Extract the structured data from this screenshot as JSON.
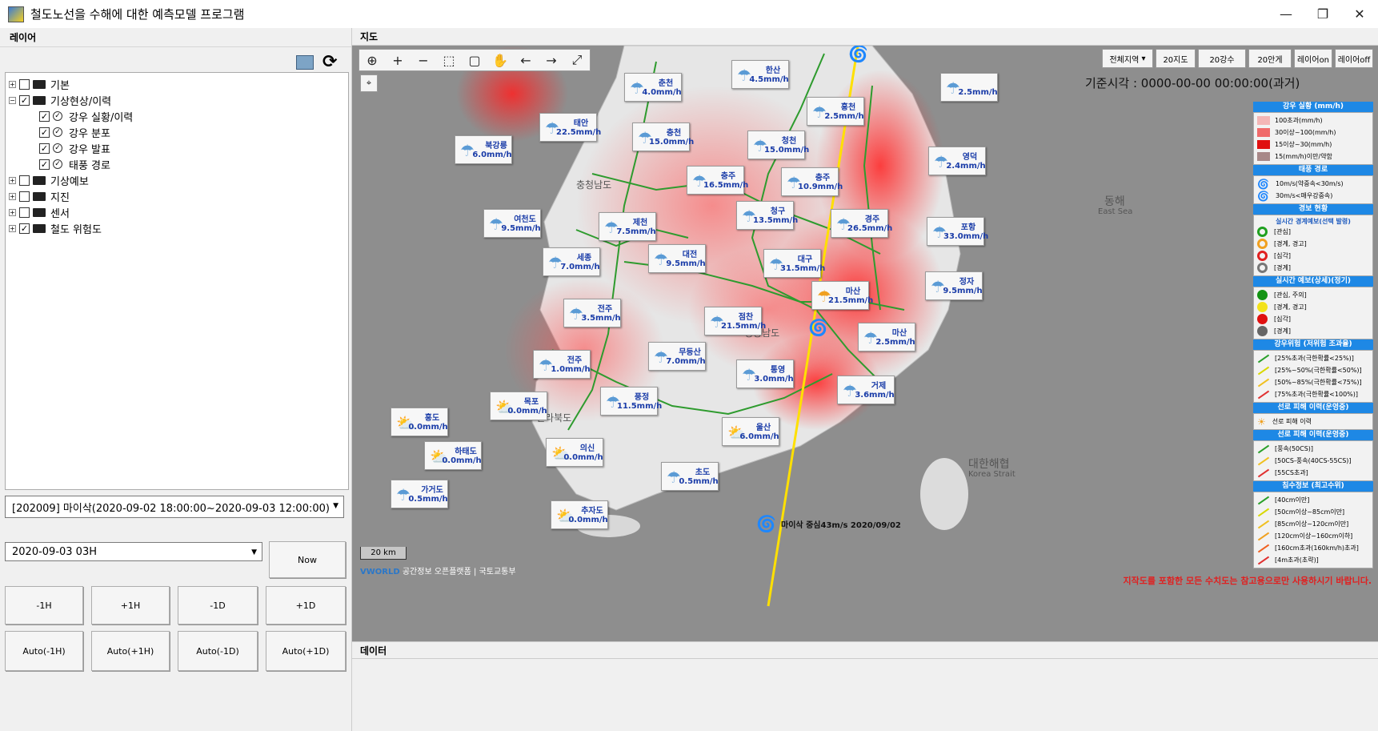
{
  "window": {
    "title": "철도노선을 수해에 대한 예측모델 프로그램",
    "minimize": "—",
    "maximize": "❐",
    "close": "✕"
  },
  "layers": {
    "header": "레이어",
    "tree": [
      {
        "label": "기본",
        "checked": false,
        "expander": "+",
        "indent": 0,
        "icon": "folder"
      },
      {
        "label": "기상현상/이력",
        "checked": true,
        "expander": "−",
        "indent": 0,
        "icon": "folder"
      },
      {
        "label": "강우 실황/이력",
        "checked": true,
        "expander": "",
        "indent": 1,
        "icon": "check-circle"
      },
      {
        "label": "강우 분포",
        "checked": true,
        "expander": "",
        "indent": 1,
        "icon": "check-circle"
      },
      {
        "label": "강우 발표",
        "checked": true,
        "expander": "",
        "indent": 1,
        "icon": "check-circle"
      },
      {
        "label": "태풍 경로",
        "checked": true,
        "expander": "",
        "indent": 1,
        "icon": "check-circle"
      },
      {
        "label": "기상예보",
        "checked": false,
        "expander": "+",
        "indent": 0,
        "icon": "folder"
      },
      {
        "label": "지진",
        "checked": false,
        "expander": "+",
        "indent": 0,
        "icon": "folder"
      },
      {
        "label": "센서",
        "checked": false,
        "expander": "+",
        "indent": 0,
        "icon": "folder"
      },
      {
        "label": "철도 위험도",
        "checked": true,
        "expander": "+",
        "indent": 0,
        "icon": "folder"
      }
    ]
  },
  "controls": {
    "event_select": "[202009] 마이삭(2020-09-02 18:00:00~2020-09-03 12:00:00)",
    "time_select": "2020-09-03 03H",
    "now": "Now",
    "step_buttons": [
      "-1H",
      "+1H",
      "-1D",
      "+1D"
    ],
    "auto_buttons": [
      "Auto(-1H)",
      "Auto(+1H)",
      "Auto(-1D)",
      "Auto(+1D)"
    ]
  },
  "map": {
    "header": "지도",
    "region_select": "전체지역",
    "region_buttons": [
      "20지도",
      "20강수",
      "20안게",
      "레이어on",
      "레이어off"
    ],
    "base_time": "기준시각 : 0000-00-00 00:00:00(과거)",
    "scale": "20 km",
    "attribution": "공간정보 오픈플랫폼 | 국토교통부",
    "brand": "VWORLD",
    "disclaimer": "지작도를 포함한 모든 수치도는 참고용으로만 사용하시기 바랍니다.",
    "typhoon_label": "마이삭 중심43m/s 2020/09/02",
    "sea_labels": [
      "동해",
      "East Sea",
      "대한해협",
      "Korea Strait",
      "경상남도",
      "전라북도",
      "충청남도"
    ],
    "stations": [
      {
        "name": "춘천",
        "value": "4.0mm/h",
        "icon": "umbrella"
      },
      {
        "name": "한산",
        "value": "4.5mm/h",
        "icon": "umbrella"
      },
      {
        "name": "",
        "value": "2.5mm/h",
        "icon": "umbrella"
      },
      {
        "name": "태안",
        "value": "22.5mm/h",
        "icon": "umbrella"
      },
      {
        "name": "흥천",
        "value": "2.5mm/h",
        "icon": "umbrella"
      },
      {
        "name": "북강릉",
        "value": "6.0mm/h",
        "icon": "umbrella"
      },
      {
        "name": "충천",
        "value": "15.0mm/h",
        "icon": "umbrella"
      },
      {
        "name": "청천",
        "value": "15.0mm/h",
        "icon": "umbrella"
      },
      {
        "name": "영덕",
        "value": "2.4mm/h",
        "icon": "umbrella"
      },
      {
        "name": "충주",
        "value": "16.5mm/h",
        "icon": "umbrella"
      },
      {
        "name": "충주",
        "value": "10.9mm/h",
        "icon": "umbrella"
      },
      {
        "name": "여천도",
        "value": "9.5mm/h",
        "icon": "umbrella"
      },
      {
        "name": "제천",
        "value": "7.5mm/h",
        "icon": "umbrella"
      },
      {
        "name": "청구",
        "value": "13.5mm/h",
        "icon": "umbrella"
      },
      {
        "name": "경주",
        "value": "26.5mm/h",
        "icon": "umbrella"
      },
      {
        "name": "포항",
        "value": "33.0mm/h",
        "icon": "umbrella"
      },
      {
        "name": "세종",
        "value": "7.0mm/h",
        "icon": "umbrella"
      },
      {
        "name": "대전",
        "value": "9.5mm/h",
        "icon": "umbrella"
      },
      {
        "name": "대구",
        "value": "31.5mm/h",
        "icon": "umbrella"
      },
      {
        "name": "정자",
        "value": "9.5mm/h",
        "icon": "umbrella"
      },
      {
        "name": "마산",
        "value": "21.5mm/h",
        "icon": "sun-umbrella"
      },
      {
        "name": "전주",
        "value": "3.5mm/h",
        "icon": "umbrella"
      },
      {
        "name": "점찬",
        "value": "21.5mm/h",
        "icon": "umbrella"
      },
      {
        "name": "마산",
        "value": "2.5mm/h",
        "icon": "umbrella"
      },
      {
        "name": "전주",
        "value": "1.0mm/h",
        "icon": "umbrella"
      },
      {
        "name": "무등산",
        "value": "7.0mm/h",
        "icon": "umbrella"
      },
      {
        "name": "통영",
        "value": "3.0mm/h",
        "icon": "umbrella"
      },
      {
        "name": "거제",
        "value": "3.6mm/h",
        "icon": "umbrella"
      },
      {
        "name": "목포",
        "value": "0.0mm/h",
        "icon": "sun-cloud"
      },
      {
        "name": "풍정",
        "value": "11.5mm/h",
        "icon": "umbrella"
      },
      {
        "name": "홍도",
        "value": "0.0mm/h",
        "icon": "sun-cloud"
      },
      {
        "name": "울산",
        "value": "6.0mm/h",
        "icon": "sun-cloud"
      },
      {
        "name": "하태도",
        "value": "0.0mm/h",
        "icon": "sun-cloud"
      },
      {
        "name": "의신",
        "value": "0.0mm/h",
        "icon": "sun-cloud"
      },
      {
        "name": "초도",
        "value": "0.5mm/h",
        "icon": "umbrella"
      },
      {
        "name": "가거도",
        "value": "0.5mm/h",
        "icon": "umbrella"
      },
      {
        "name": "추자도",
        "value": "0.0mm/h",
        "icon": "sun-cloud"
      }
    ]
  },
  "legend": {
    "rain_title": "강우 실황 (mm/h)",
    "rain": [
      {
        "label": "100초과(mm/h)",
        "color": "#f4b6b6"
      },
      {
        "label": "30이상~100(mm/h)",
        "color": "#f06a6a"
      },
      {
        "label": "15이상~30(mm/h)",
        "color": "#e01010"
      },
      {
        "label": "15(mm/h)이만/약함",
        "color": "#a88888"
      }
    ],
    "wind_title": "태풍 경로",
    "wind": [
      {
        "label": "10m/s(약중속<30m/s)"
      },
      {
        "label": "30m/s<매우강중속)"
      }
    ],
    "warn_title": "경보 현황",
    "warn_sub": "실시간 경계예보(선택 발령)",
    "warn": [
      {
        "label": "[관심]",
        "color": "#20a020"
      },
      {
        "label": "[경계, 경고]",
        "color": "#f0a020"
      },
      {
        "label": "[심각]",
        "color": "#e02020"
      },
      {
        "label": "[경계]",
        "color": "#777777"
      }
    ],
    "rt_title": "실시간 예보(상세)(정기)",
    "rt": [
      {
        "label": "[관심, 주의]",
        "color": "#139313"
      },
      {
        "label": "[경계, 경고]",
        "color": "#f3e21b"
      },
      {
        "label": "[심각]",
        "color": "#e01010"
      },
      {
        "label": "[경계]",
        "color": "#666666"
      }
    ],
    "prob_title": "강우위험 (저위험 조과율)",
    "prob": [
      {
        "label": "[25%초과(극한확률<25%)]",
        "color": "#2aa02a"
      },
      {
        "label": "[25%~50%(극한확률<50%)]",
        "color": "#d8d800"
      },
      {
        "label": "[50%~85%(극한확률<75%)]",
        "color": "#f0c020"
      },
      {
        "label": "[75%초과(극한확률<100%)]",
        "color": "#e03030"
      }
    ],
    "dmg_title": "선로 피해 이력(운영중)",
    "dmg": [
      {
        "label": "선로 피해 이력"
      }
    ],
    "line_title": "선로 피해 이력(운영중)",
    "line": [
      {
        "label": "[풍속(50CS)]",
        "color": "#2aa02a"
      },
      {
        "label": "[50CS-풍속(40CS-55CS)]",
        "color": "#f0c020"
      },
      {
        "label": "[55CS초과]",
        "color": "#e03030"
      }
    ],
    "water_title": "침수정보 (최고수위)",
    "water": [
      {
        "label": "[40cm이만]",
        "color": "#2aa02a"
      },
      {
        "label": "[50cm이상~85cm이만]",
        "color": "#d8d800"
      },
      {
        "label": "[85cm이상~120cm이만]",
        "color": "#f0c020"
      },
      {
        "label": "[120cm이상~160cm이하]",
        "color": "#f0a020"
      },
      {
        "label": "[160cm초과(160km/h)초과]",
        "color": "#f06020"
      },
      {
        "label": "[4m초과(초략)]",
        "color": "#e03030"
      }
    ]
  },
  "data_panel": {
    "header": "데이터"
  }
}
